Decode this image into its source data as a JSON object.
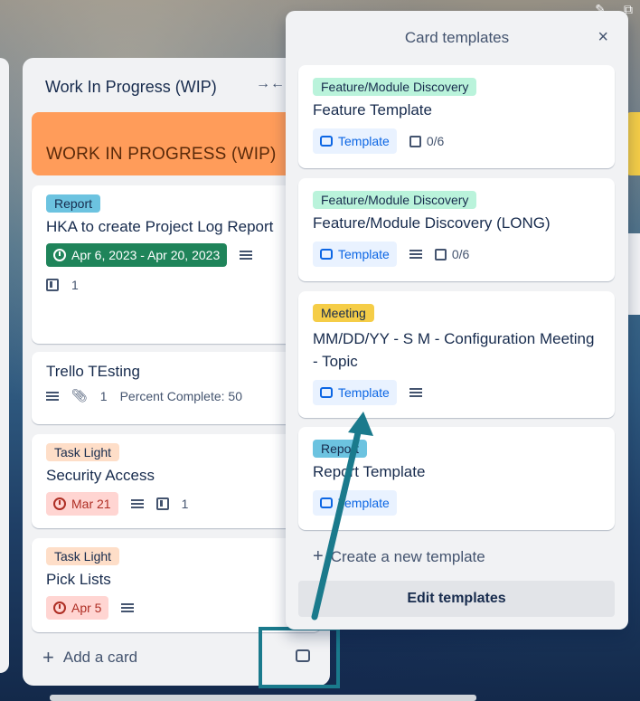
{
  "list": {
    "title": "Work In Progress (WIP)",
    "cover_title": "WORK IN PROGRESS (WIP)",
    "add_card": "Add a card"
  },
  "cards": [
    {
      "label": "Report",
      "title": "HKA to create Project Log Report",
      "date": "Apr 6, 2023 - Apr 20, 2023",
      "board_count": "1"
    },
    {
      "title": "Trello TEsting",
      "attachments": "1",
      "custom_field": "Percent Complete: 50"
    },
    {
      "label": "Task Light",
      "title": "Security Access",
      "date": "Mar 21",
      "board_count": "1"
    },
    {
      "label": "Task Light",
      "title": "Pick Lists",
      "date": "Apr 5"
    }
  ],
  "popover": {
    "title": "Card templates",
    "close": "×",
    "templates": [
      {
        "label": "Feature/Module Discovery",
        "title": "Feature Template",
        "badge": "Template",
        "checklist": "0/6"
      },
      {
        "label": "Feature/Module Discovery",
        "title": "Feature/Module Discovery (LONG)",
        "badge": "Template",
        "checklist": "0/6"
      },
      {
        "label": "Meeting",
        "title": "MM/DD/YY - S M - Configuration Meeting - Topic",
        "badge": "Template"
      },
      {
        "label": "Report",
        "title": "Report Template",
        "badge": "Template"
      }
    ],
    "create_new": "Create a new template",
    "edit": "Edit templates"
  },
  "colors": {
    "cover": "#ff9c5a",
    "annotation": "#1a7a8c",
    "date_green": "#1f845a",
    "date_red": "#ffd5d2"
  }
}
